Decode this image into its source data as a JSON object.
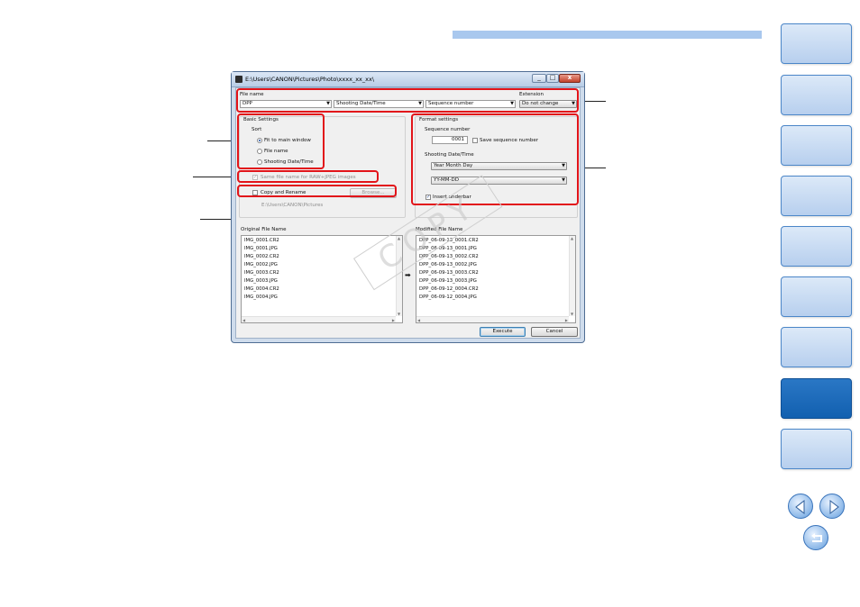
{
  "window": {
    "title": "E:\\Users\\CANON\\Pictures\\Photo\\xxxx_xx_xx\\",
    "minimize": "_",
    "maximize": "□",
    "close": "x"
  },
  "file_name": {
    "label": "File name",
    "field1": "DPP",
    "field2": "Shooting Date/Time",
    "field3": "Sequence number",
    "extension_label": "Extension",
    "extension_value": "Do not change"
  },
  "basic_settings": {
    "title": "Basic Settings",
    "sort_label": "Sort",
    "options": [
      "Fit to main window",
      "File name",
      "Shooting Date/Time"
    ],
    "selected_index": 0,
    "same_name_label": "Same file name for RAW+JPEG images",
    "same_name_checked": true,
    "copy_rename_label": "Copy and Rename",
    "copy_rename_checked": false,
    "browse_label": "Browse...",
    "dest_path": "E:\\Users\\CANON\\Pictures"
  },
  "format_settings": {
    "title": "Format settings",
    "seq_label": "Sequence number",
    "seq_value": "0001",
    "save_seq_label": "Save sequence number",
    "save_seq_checked": false,
    "shooting_label": "Shooting Date/Time",
    "date_order": "Year Month Day",
    "date_format": "YY-MM-DD",
    "underbar_label": "Insert underbar",
    "underbar_checked": true
  },
  "original": {
    "label": "Original File Name",
    "files": [
      "IMG_0001.CR2",
      "IMG_0001.JPG",
      "IMG_0002.CR2",
      "IMG_0002.JPG",
      "IMG_0003.CR2",
      "IMG_0003.JPG",
      "IMG_0004.CR2",
      "IMG_0004.JPG"
    ]
  },
  "modified": {
    "label": "Modified File Name",
    "files": [
      "DPP_06-09-13_0001.CR2",
      "DPP_06-09-13_0001.JPG",
      "DPP_06-09-13_0002.CR2",
      "DPP_06-09-13_0002.JPG",
      "DPP_06-09-13_0003.CR2",
      "DPP_06-09-13_0003.JPG",
      "DPP_06-09-12_0004.CR2",
      "DPP_06-09-12_0004.JPG"
    ]
  },
  "arrow_glyph": "➡",
  "buttons": {
    "execute": "Execute",
    "cancel": "Cancel"
  },
  "watermark": "COPY",
  "colors": {
    "accent_bar": "#a9c8ee",
    "side_tab": "#c9dbf2",
    "side_tab_active": "#1565b6",
    "callout": "#e2141a"
  },
  "side_tabs": {
    "count": 9,
    "active_index": 7
  },
  "nav": {
    "prev_icon": "left-arrow-icon",
    "next_icon": "right-arrow-icon",
    "back_icon": "return-icon"
  }
}
